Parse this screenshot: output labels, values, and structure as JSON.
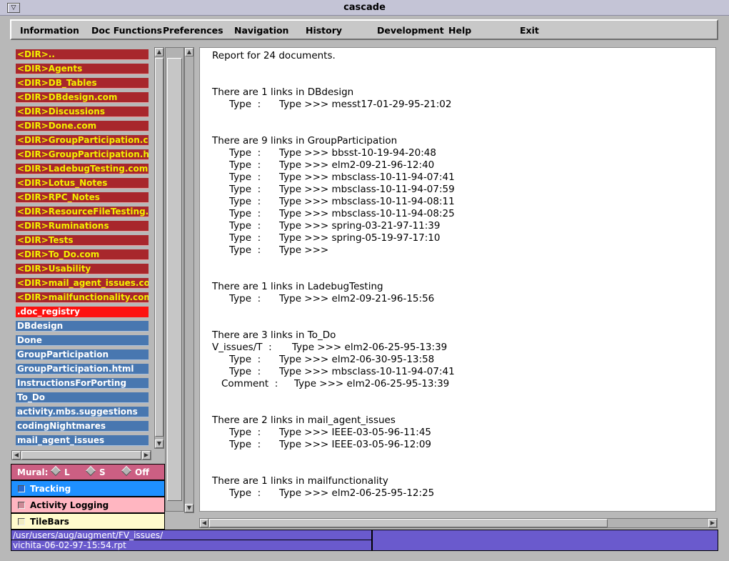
{
  "window": {
    "title": "cascade"
  },
  "menubar": [
    {
      "label": "Information",
      "name": "menu-information"
    },
    {
      "label": "Doc Functions",
      "name": "menu-doc-functions"
    },
    {
      "label": "Preferences",
      "name": "menu-preferences"
    },
    {
      "label": "Navigation",
      "name": "menu-navigation"
    },
    {
      "label": "History",
      "name": "menu-history"
    },
    {
      "label": "Development",
      "name": "menu-development"
    },
    {
      "label": "Help",
      "name": "menu-help"
    },
    {
      "label": "Exit",
      "name": "menu-exit"
    }
  ],
  "filelist": [
    {
      "label": "<DIR>..",
      "kind": "dir"
    },
    {
      "label": "<DIR>Agents",
      "kind": "dir"
    },
    {
      "label": "<DIR>DB_Tables",
      "kind": "dir"
    },
    {
      "label": "<DIR>DBdesign.com",
      "kind": "dir"
    },
    {
      "label": "<DIR>Discussions",
      "kind": "dir"
    },
    {
      "label": "<DIR>Done.com",
      "kind": "dir"
    },
    {
      "label": "<DIR>GroupParticipation.com",
      "kind": "dir"
    },
    {
      "label": "<DIR>GroupParticipation.html.c",
      "kind": "dir"
    },
    {
      "label": "<DIR>LadebugTesting.com",
      "kind": "dir"
    },
    {
      "label": "<DIR>Lotus_Notes",
      "kind": "dir"
    },
    {
      "label": "<DIR>RPC_Notes",
      "kind": "dir"
    },
    {
      "label": "<DIR>ResourceFileTesting.com",
      "kind": "dir"
    },
    {
      "label": "<DIR>Ruminations",
      "kind": "dir"
    },
    {
      "label": "<DIR>Tests",
      "kind": "dir"
    },
    {
      "label": "<DIR>To_Do.com",
      "kind": "dir"
    },
    {
      "label": "<DIR>Usability",
      "kind": "dir"
    },
    {
      "label": "<DIR>mail_agent_issues.com",
      "kind": "dir"
    },
    {
      "label": "<DIR>mailfunctionality.com",
      "kind": "dir"
    },
    {
      "label": ".doc_registry",
      "kind": "reg"
    },
    {
      "label": "DBdesign",
      "kind": "doc"
    },
    {
      "label": "Done",
      "kind": "doc"
    },
    {
      "label": "GroupParticipation",
      "kind": "doc"
    },
    {
      "label": "GroupParticipation.html",
      "kind": "doc"
    },
    {
      "label": "InstructionsForPorting",
      "kind": "doc"
    },
    {
      "label": "To_Do",
      "kind": "doc"
    },
    {
      "label": "activity.mbs.suggestions",
      "kind": "doc"
    },
    {
      "label": "codingNightmares",
      "kind": "doc"
    },
    {
      "label": "mail_agent_issues",
      "kind": "doc"
    }
  ],
  "mural": {
    "label": "Mural:",
    "options": [
      "L",
      "S",
      "Off"
    ]
  },
  "toggles": {
    "tracking": "Tracking",
    "activity_logging": "Activity Logging",
    "tilebars": "TileBars"
  },
  "report": {
    "summary": "Report for 24 documents.",
    "groups": [
      {
        "header": "There are 1 links in DBdesign",
        "rows": [
          {
            "t": "Type",
            "v": "messt17-01-29-95-21:02"
          }
        ]
      },
      {
        "header": "There are 9 links in GroupParticipation",
        "rows": [
          {
            "t": "Type",
            "v": "bbsst-10-19-94-20:48"
          },
          {
            "t": "Type",
            "v": "elm2-09-21-96-12:40"
          },
          {
            "t": "Type",
            "v": "mbsclass-10-11-94-07:41"
          },
          {
            "t": "Type",
            "v": "mbsclass-10-11-94-07:59"
          },
          {
            "t": "Type",
            "v": "mbsclass-10-11-94-08:11"
          },
          {
            "t": "Type",
            "v": "mbsclass-10-11-94-08:25"
          },
          {
            "t": "Type",
            "v": "spring-03-21-97-11:39"
          },
          {
            "t": "Type",
            "v": "spring-05-19-97-17:10"
          },
          {
            "t": "Type",
            "v": ""
          }
        ]
      },
      {
        "header": "There are 1 links in LadebugTesting",
        "rows": [
          {
            "t": "Type",
            "v": "elm2-09-21-96-15:56"
          }
        ]
      },
      {
        "header": "There are 3 links in To_Do",
        "rows": [
          {
            "t": "V_issues/T",
            "v": "elm2-06-25-95-13:39"
          },
          {
            "t": "Type",
            "v": "elm2-06-30-95-13:58"
          },
          {
            "t": "Type",
            "v": "mbsclass-10-11-94-07:41"
          },
          {
            "t": "Comment",
            "v": "elm2-06-25-95-13:39"
          }
        ]
      },
      {
        "header": "There are 2 links in mail_agent_issues",
        "rows": [
          {
            "t": "Type",
            "v": "IEEE-03-05-96-11:45"
          },
          {
            "t": "Type",
            "v": "IEEE-03-05-96-12:09"
          }
        ]
      },
      {
        "header": "There are 1 links in mailfunctionality",
        "rows": [
          {
            "t": "Type",
            "v": "elm2-06-25-95-12:25"
          }
        ]
      }
    ]
  },
  "status": {
    "path_line1": "/usr/users/aug/augment/FV_issues/",
    "path_line2": "vichita-06-02-97-15:54.rpt"
  }
}
